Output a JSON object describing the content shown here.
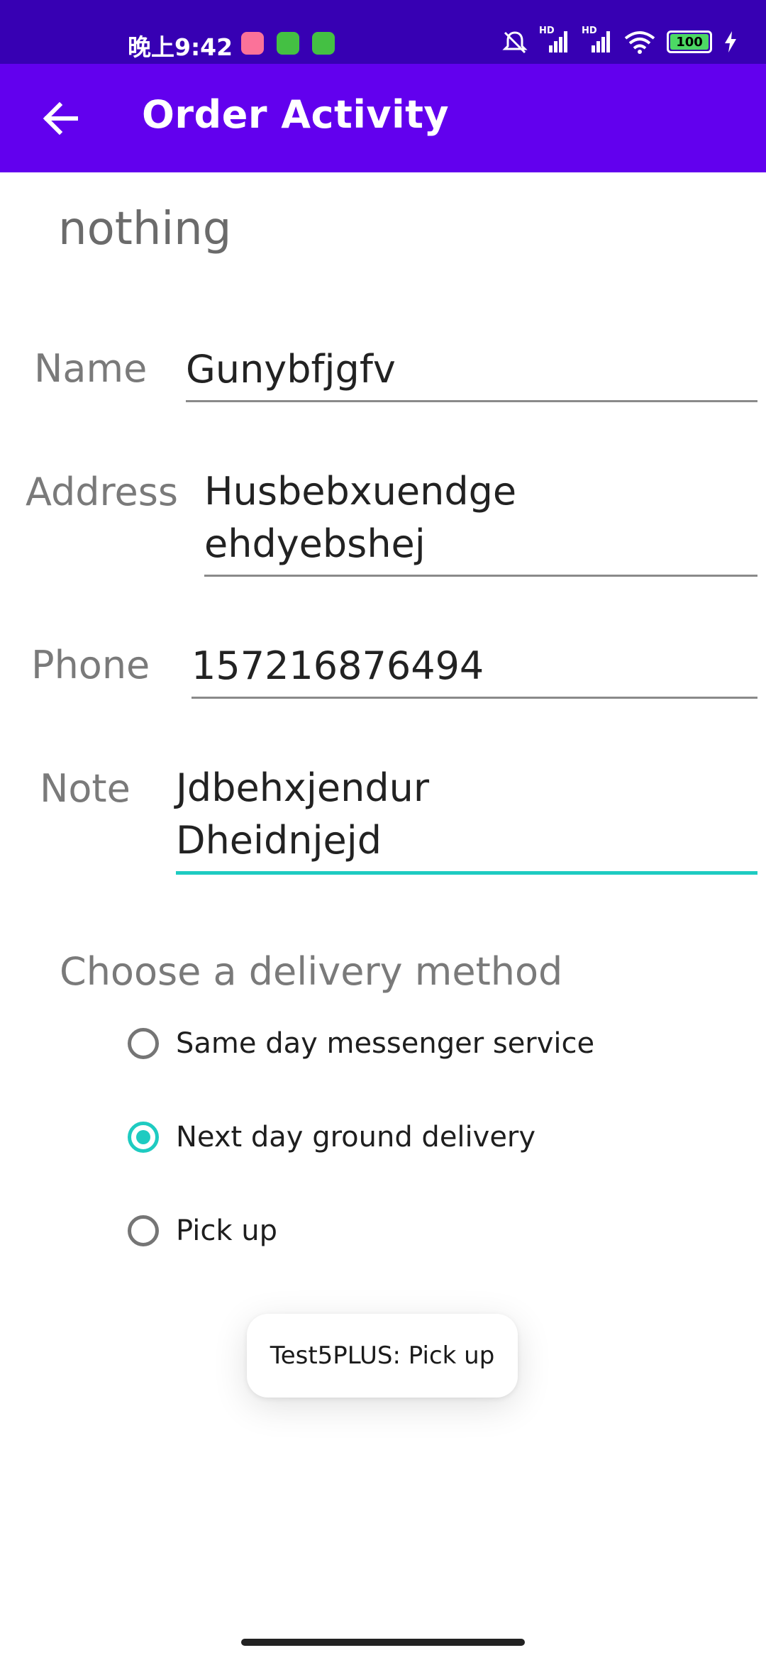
{
  "status_bar": {
    "time": "晚上9:42",
    "battery": "100",
    "network_labels": [
      "HD",
      "HD"
    ]
  },
  "app_bar": {
    "title": "Order Activity"
  },
  "content": {
    "status_text": "nothing",
    "fields": {
      "name": {
        "label": "Name",
        "value": "Gunybfjgfv"
      },
      "address": {
        "label": "Address",
        "value": "Husbebxuendge\nehdyebshej"
      },
      "phone": {
        "label": "Phone",
        "value": "157216876494"
      },
      "note": {
        "label": "Note",
        "value": "Jdbehxjendur\nDheidnjejd"
      }
    },
    "delivery": {
      "heading": "Choose a delivery method",
      "options": [
        {
          "label": "Same day messenger service",
          "checked": false
        },
        {
          "label": "Next day ground delivery",
          "checked": true
        },
        {
          "label": "Pick up",
          "checked": false
        }
      ]
    }
  },
  "toast": {
    "message": "Test5PLUS: Pick up"
  },
  "colors": {
    "status_bar": "#3700B3",
    "app_bar": "#6200EE",
    "accent": "#1ECBC1"
  }
}
